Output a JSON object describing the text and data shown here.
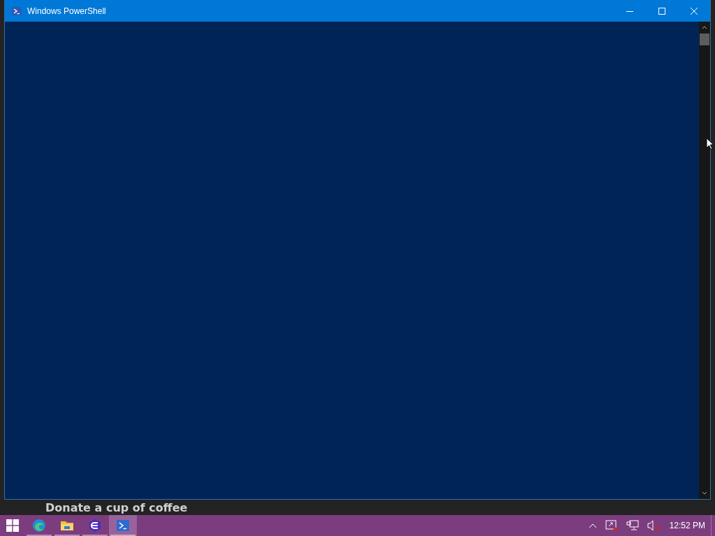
{
  "background_page": {
    "text": "Donate a cup of coffee"
  },
  "window": {
    "title": "Windows PowerShell"
  },
  "taskbar": {
    "apps": [
      {
        "kind": "browser",
        "selected": false
      },
      {
        "kind": "folder",
        "selected": false
      },
      {
        "kind": "app",
        "selected": false
      },
      {
        "kind": "shell",
        "selected": true
      }
    ],
    "clock": "12:52 PM"
  }
}
